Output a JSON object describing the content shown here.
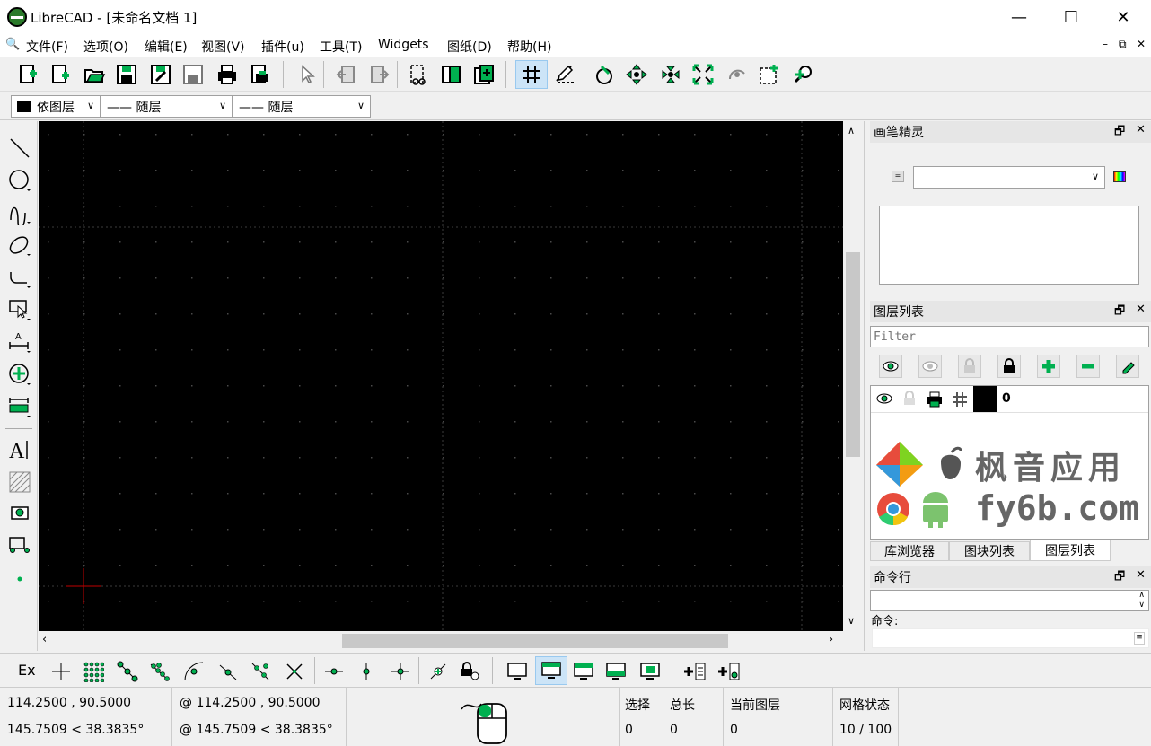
{
  "window": {
    "title": "LibreCAD - [未命名文档 1]",
    "minimize": "—",
    "maximize": "☐",
    "close": "✕"
  },
  "menu": [
    "文件(F)",
    "选项(O)",
    "编辑(E)",
    "视图(V)",
    "插件(u)",
    "工具(T)",
    "Widgets",
    "图纸(D)",
    "帮助(H)"
  ],
  "mdi": {
    "min": "–",
    "restore": "⧉",
    "close": "✕"
  },
  "pen": {
    "color": "依图层",
    "linetype": "—— 随层",
    "width": "—— 随层"
  },
  "right": {
    "pen_wizard_title": "画笔精灵",
    "layer_list_title": "图层列表",
    "filter_placeholder": "Filter",
    "layer": {
      "name": "0"
    },
    "tabs": [
      "库浏览器",
      "图块列表",
      "图层列表"
    ],
    "cmd_title": "命令行",
    "cmd_label": "命令:",
    "float": "🗗",
    "close": "✕"
  },
  "watermark": {
    "line1": "枫音应用",
    "line2": "fy6b.com"
  },
  "snap": {
    "ex_label": "Ex"
  },
  "status": {
    "abs_coord": "114.2500 , 90.5000",
    "abs_polar": "145.7509 < 38.3835°",
    "rel_coord": "@  114.2500 , 90.5000",
    "rel_polar": "@  145.7509 < 38.3835°",
    "sel_label": "选择",
    "sel_value": "0",
    "total_label": "总长",
    "total_value": "0",
    "layer_label": "当前图层",
    "layer_value": "0",
    "grid_label": "网格状态",
    "grid_value": "10 / 100"
  },
  "colors": {
    "accent": "#00cc66",
    "canvas": "#000000",
    "axis": "#cc0000"
  }
}
